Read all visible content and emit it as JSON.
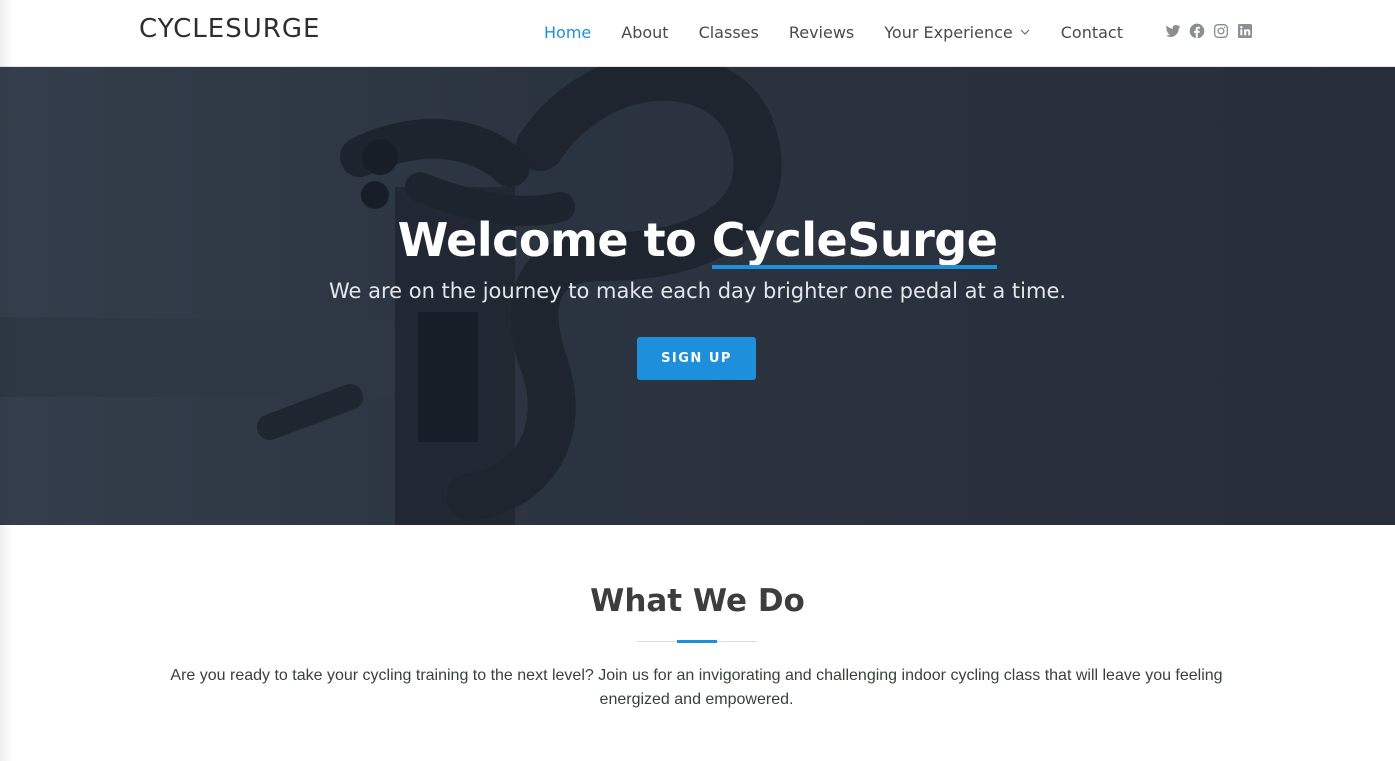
{
  "header": {
    "logo": "CYCLESURGE",
    "nav": [
      {
        "label": "Home",
        "active": true
      },
      {
        "label": "About"
      },
      {
        "label": "Classes"
      },
      {
        "label": "Reviews"
      },
      {
        "label": "Your Experience",
        "dropdown": true
      },
      {
        "label": "Contact"
      }
    ],
    "socials": [
      "twitter-icon",
      "facebook-icon",
      "instagram-icon",
      "linkedin-icon"
    ]
  },
  "hero": {
    "title_prefix": "Welcome to ",
    "title_brand": "CycleSurge",
    "subtitle": "We are on the journey to make each day brighter one pedal at a time.",
    "cta": "SIGN UP"
  },
  "section": {
    "title": "What We Do",
    "text": "Are you ready to take your cycling training to the next level? Join us for an invigorating and challenging indoor cycling class that will leave you feeling energized and empowered."
  },
  "colors": {
    "accent": "#1e8fdb",
    "hero_overlay": "#2b333e",
    "text_dark": "#3d3d3d"
  }
}
